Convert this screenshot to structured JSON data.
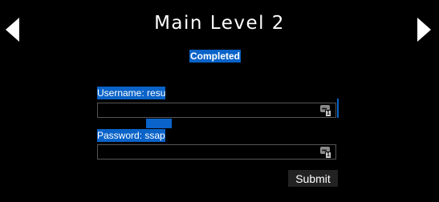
{
  "header": {
    "title": "Main Level 2",
    "prev_icon": "triangle-left-icon",
    "next_icon": "triangle-right-icon"
  },
  "status": {
    "text": "Completed"
  },
  "form": {
    "username": {
      "label": "Username: resu",
      "value": "",
      "icon": "password-manager-icon",
      "icon_badge": "1"
    },
    "password": {
      "label": "Password: ssap",
      "value": "",
      "icon": "password-manager-icon",
      "icon_badge": "1"
    },
    "submit_label": "Submit"
  },
  "colors": {
    "background": "#000000",
    "highlight": "#0a63c8",
    "text": "#ffffff",
    "button": "#222222"
  }
}
